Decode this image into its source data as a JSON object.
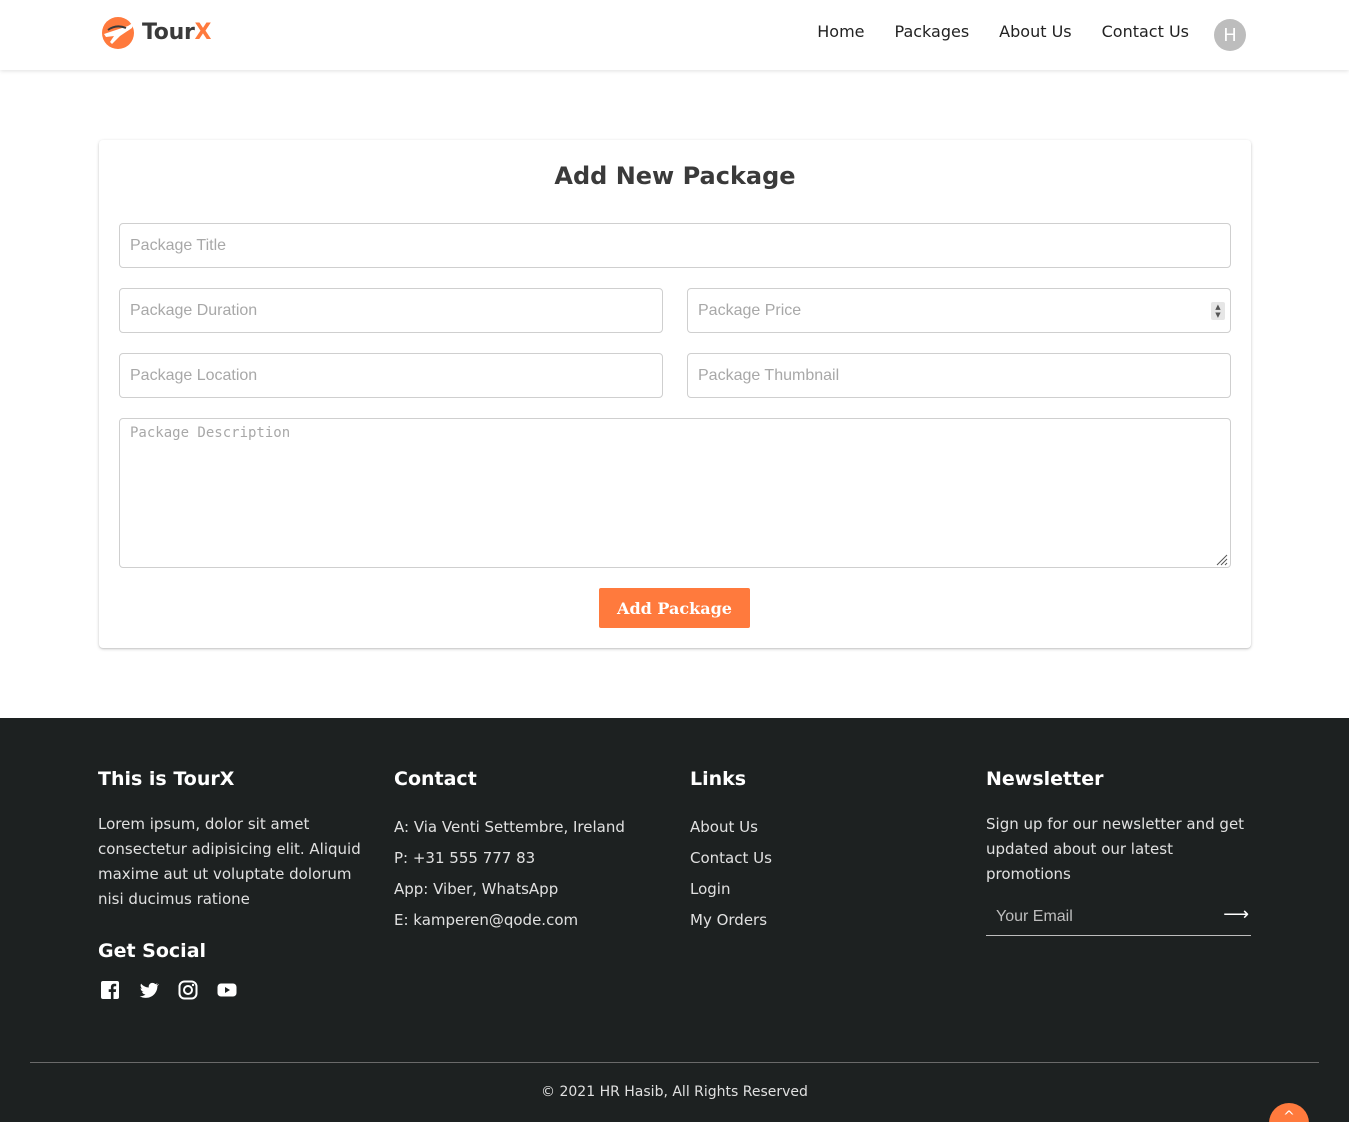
{
  "brand": {
    "name_main": "Tour",
    "name_accent": "X",
    "accent_color": "#ff7a3d"
  },
  "nav": {
    "items": [
      "Home",
      "Packages",
      "About Us",
      "Contact Us"
    ],
    "avatar_initial": "H"
  },
  "form": {
    "title": "Add New Package",
    "placeholders": {
      "title": "Package Title",
      "duration": "Package Duration",
      "price": "Package Price",
      "location": "Package Location",
      "thumbnail": "Package Thumbnail",
      "description": "Package Description"
    },
    "submit_label": "Add Package"
  },
  "footer": {
    "about": {
      "heading": "This is TourX",
      "text": "Lorem ipsum, dolor sit amet consectetur adipisicing elit. Aliquid maxime aut ut voluptate dolorum nisi ducimus ratione"
    },
    "social": {
      "heading": "Get Social",
      "icons": [
        "facebook-icon",
        "twitter-icon",
        "instagram-icon",
        "youtube-icon"
      ]
    },
    "contact": {
      "heading": "Contact",
      "lines": [
        "A: Via Venti Settembre, Ireland",
        "P: +31 555 777 83",
        "App: Viber, WhatsApp",
        "E: kamperen@qode.com"
      ]
    },
    "links": {
      "heading": "Links",
      "items": [
        "About Us",
        "Contact Us",
        "Login",
        "My Orders"
      ]
    },
    "newsletter": {
      "heading": "Newsletter",
      "text": "Sign up for our newsletter and get updated about our latest promotions",
      "placeholder": "Your Email"
    },
    "copyright": "© 2021 HR Hasib, All Rights Reserved"
  },
  "colors": {
    "accent": "#ff7a3d",
    "footer_bg": "#1d2121"
  }
}
